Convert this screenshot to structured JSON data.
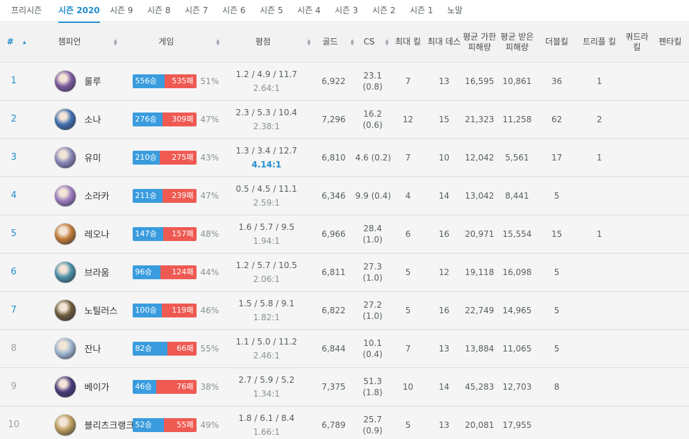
{
  "tabs": [
    {
      "label": "프리시즌"
    },
    {
      "label": "시즌 2020"
    },
    {
      "label": "시즌 9"
    },
    {
      "label": "시즌 8"
    },
    {
      "label": "시즌 7"
    },
    {
      "label": "시즌 6"
    },
    {
      "label": "시즌 5"
    },
    {
      "label": "시즌 4"
    },
    {
      "label": "시즌 3"
    },
    {
      "label": "시즌 2"
    },
    {
      "label": "시즌 1"
    },
    {
      "label": "노말"
    }
  ],
  "active_tab": "시즌 2020",
  "headers": {
    "rank": "#",
    "champion": "챔피언",
    "games": "게임",
    "kda": "평점",
    "gold": "골드",
    "cs": "CS",
    "max_kills": "최대 킬",
    "max_deaths": "최대 데스",
    "avg_dealt": "평균 가한 피해량",
    "avg_taken": "평균 받은 피해량",
    "double": "더블킬",
    "triple": "트리플 킬",
    "quadra": "쿼드라 킬",
    "penta": "펜타킬"
  },
  "colors": {
    "accent": "#1f8ecd",
    "win": "#3a9cde",
    "loss": "#ee5a52"
  },
  "rows": [
    {
      "rank": "1",
      "name": "룰루",
      "avatar_color": "#7c5a9e",
      "wins": "556승",
      "losses": "535패",
      "win_frac": 0.51,
      "winrate": "51%",
      "kda": "1.2 / 4.9 / 11.7",
      "ratio": "2.64:1",
      "ratio_highlight": false,
      "gold": "6,922",
      "cs": "23.1",
      "cs_per_min": "(0.8)",
      "max_kills": "7",
      "max_deaths": "13",
      "dealt": "16,595",
      "taken": "10,861",
      "double": "36",
      "triple": "1",
      "quadra": "",
      "penta": ""
    },
    {
      "rank": "2",
      "name": "소나",
      "avatar_color": "#3f6fae",
      "wins": "276승",
      "losses": "309패",
      "win_frac": 0.47,
      "winrate": "47%",
      "kda": "2.3 / 5.3 / 10.4",
      "ratio": "2.38:1",
      "ratio_highlight": false,
      "gold": "7,296",
      "cs": "16.2",
      "cs_per_min": "(0.6)",
      "max_kills": "12",
      "max_deaths": "15",
      "dealt": "21,323",
      "taken": "11,258",
      "double": "62",
      "triple": "2",
      "quadra": "",
      "penta": ""
    },
    {
      "rank": "3",
      "name": "유미",
      "avatar_color": "#8a86b8",
      "wins": "210승",
      "losses": "275패",
      "win_frac": 0.43,
      "winrate": "43%",
      "kda": "1.3 / 3.4 / 12.7",
      "ratio": "4.14:1",
      "ratio_highlight": true,
      "gold": "6,810",
      "cs": "4.6 (0.2)",
      "cs_per_min": "",
      "max_kills": "7",
      "max_deaths": "10",
      "dealt": "12,042",
      "taken": "5,561",
      "double": "17",
      "triple": "1",
      "quadra": "",
      "penta": ""
    },
    {
      "rank": "4",
      "name": "소라카",
      "avatar_color": "#9b7bbd",
      "wins": "211승",
      "losses": "239패",
      "win_frac": 0.47,
      "winrate": "47%",
      "kda": "0.5 / 4.5 / 11.1",
      "ratio": "2.59:1",
      "ratio_highlight": false,
      "gold": "6,346",
      "cs": "9.9 (0.4)",
      "cs_per_min": "",
      "max_kills": "4",
      "max_deaths": "14",
      "dealt": "13,042",
      "taken": "8,441",
      "double": "5",
      "triple": "",
      "quadra": "",
      "penta": ""
    },
    {
      "rank": "5",
      "name": "레오나",
      "avatar_color": "#c07a36",
      "wins": "147승",
      "losses": "157패",
      "win_frac": 0.48,
      "winrate": "48%",
      "kda": "1.6 / 5.7 / 9.5",
      "ratio": "1.94:1",
      "ratio_highlight": false,
      "gold": "6,966",
      "cs": "28.4",
      "cs_per_min": "(1.0)",
      "max_kills": "6",
      "max_deaths": "16",
      "dealt": "20,971",
      "taken": "15,554",
      "double": "15",
      "triple": "1",
      "quadra": "",
      "penta": ""
    },
    {
      "rank": "6",
      "name": "브라움",
      "avatar_color": "#4b8fa8",
      "wins": "96승",
      "losses": "124패",
      "win_frac": 0.44,
      "winrate": "44%",
      "kda": "1.2 / 5.7 / 10.5",
      "ratio": "2.06:1",
      "ratio_highlight": false,
      "gold": "6,811",
      "cs": "27.3",
      "cs_per_min": "(1.0)",
      "max_kills": "5",
      "max_deaths": "12",
      "dealt": "19,118",
      "taken": "16,098",
      "double": "5",
      "triple": "",
      "quadra": "",
      "penta": ""
    },
    {
      "rank": "7",
      "name": "노틸러스",
      "avatar_color": "#6b5a3a",
      "wins": "100승",
      "losses": "119패",
      "win_frac": 0.46,
      "winrate": "46%",
      "kda": "1.5 / 5.8 / 9.1",
      "ratio": "1.82:1",
      "ratio_highlight": false,
      "gold": "6,822",
      "cs": "27.2",
      "cs_per_min": "(1.0)",
      "max_kills": "5",
      "max_deaths": "16",
      "dealt": "22,749",
      "taken": "14,965",
      "double": "5",
      "triple": "",
      "quadra": "",
      "penta": ""
    },
    {
      "rank": "8",
      "name": "잔나",
      "avatar_color": "#9fb6cf",
      "wins": "82승",
      "losses": "66패",
      "win_frac": 0.55,
      "winrate": "55%",
      "kda": "1.1 / 5.0 / 11.2",
      "ratio": "2.46:1",
      "ratio_highlight": false,
      "gold": "6,844",
      "cs": "10.1",
      "cs_per_min": "(0.4)",
      "max_kills": "7",
      "max_deaths": "13",
      "dealt": "13,884",
      "taken": "11,065",
      "double": "5",
      "triple": "",
      "quadra": "",
      "penta": ""
    },
    {
      "rank": "9",
      "name": "베이가",
      "avatar_color": "#4a3a7a",
      "wins": "46승",
      "losses": "76패",
      "win_frac": 0.38,
      "winrate": "38%",
      "kda": "2.7 / 5.9 / 5.2",
      "ratio": "1.34:1",
      "ratio_highlight": false,
      "gold": "7,375",
      "cs": "51.3",
      "cs_per_min": "(1.8)",
      "max_kills": "10",
      "max_deaths": "14",
      "dealt": "45,283",
      "taken": "12,703",
      "double": "8",
      "triple": "",
      "quadra": "",
      "penta": ""
    },
    {
      "rank": "10",
      "name": "블리츠크랭크",
      "avatar_color": "#b89a5a",
      "wins": "52승",
      "losses": "55패",
      "win_frac": 0.49,
      "winrate": "49%",
      "kda": "1.8 / 6.1 / 8.4",
      "ratio": "1.66:1",
      "ratio_highlight": false,
      "gold": "6,789",
      "cs": "25.7",
      "cs_per_min": "(0.9)",
      "max_kills": "5",
      "max_deaths": "13",
      "dealt": "20,081",
      "taken": "17,955",
      "double": "",
      "triple": "",
      "quadra": "",
      "penta": ""
    }
  ]
}
